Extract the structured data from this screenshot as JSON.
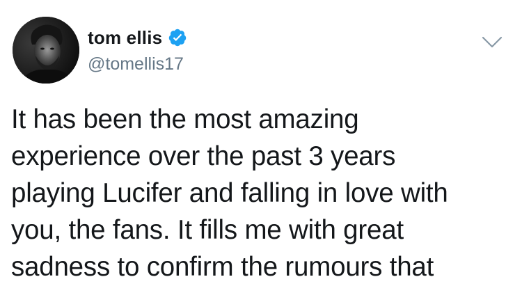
{
  "tweet": {
    "author": {
      "display_name": "tom ellis",
      "handle": "@tomellis17",
      "verified": true,
      "avatar_icon": "profile-photo"
    },
    "menu_icon": "chevron-down-icon",
    "text_lines": [
      "It has been the most amazing",
      "experience over the past 3 years",
      "playing Lucifer and falling in love with",
      "you, the fans. It fills me with great",
      "sadness to confirm the rumours that"
    ]
  },
  "colors": {
    "verified_blue": "#1da1f2",
    "handle_gray": "#657786",
    "text": "#14171a",
    "caret_gray": "#8899a6"
  }
}
